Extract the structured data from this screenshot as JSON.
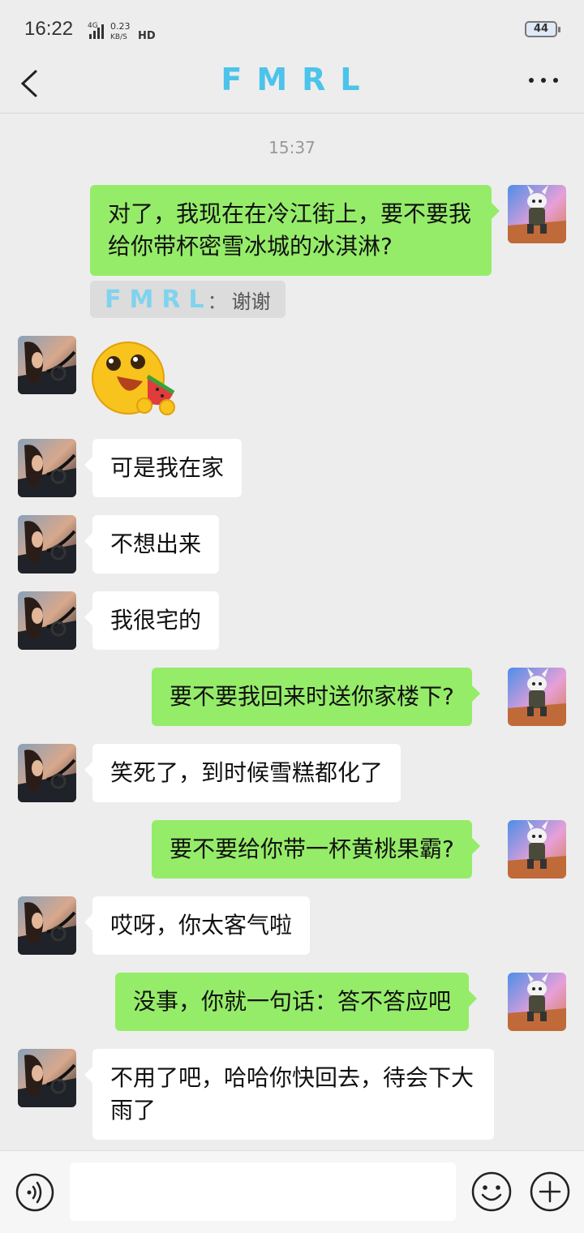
{
  "status": {
    "time": "16:22",
    "network": "4G",
    "speed": "0.23",
    "speed_unit": "KB/S",
    "hd": "HD",
    "battery": "44"
  },
  "header": {
    "title": "FMRL",
    "back_icon": "chevron-left-icon",
    "more_icon": "more-dots-icon"
  },
  "chat": {
    "timestamp": "15:37",
    "messages": [
      {
        "side": "right",
        "type": "text",
        "text": "对了，我现在在冷江街上，要不要我给你带杯密雪冰城的冰淇淋?"
      },
      {
        "side": "right",
        "type": "quote",
        "name": "FMRL",
        "sep": "：",
        "text": "谢谢"
      },
      {
        "side": "left",
        "type": "sticker",
        "icon": "watermelon-face-sticker"
      },
      {
        "side": "left",
        "type": "text",
        "text": "可是我在家"
      },
      {
        "side": "left",
        "type": "text",
        "text": "不想出来"
      },
      {
        "side": "left",
        "type": "text",
        "text": "我很宅的"
      },
      {
        "side": "right",
        "type": "text",
        "text": "要不要我回来时送你家楼下?"
      },
      {
        "side": "left",
        "type": "text",
        "text": "笑死了，到时候雪糕都化了"
      },
      {
        "side": "right",
        "type": "text",
        "text": "要不要给你带一杯黄桃果霸?"
      },
      {
        "side": "left",
        "type": "text",
        "text": "哎呀，你太客气啦"
      },
      {
        "side": "right",
        "type": "text",
        "text": "没事，你就一句话：答不答应吧"
      },
      {
        "side": "left",
        "type": "text",
        "text": "不用了吧，哈哈你快回去，待会下大雨了"
      }
    ]
  },
  "input_bar": {
    "voice_icon": "voice-icon",
    "input_value": "",
    "emoji_icon": "emoji-icon",
    "plus_icon": "plus-icon"
  },
  "colors": {
    "title": "#4cc3ea",
    "sent_bubble": "#95ec69",
    "received_bubble": "#ffffff",
    "background": "#ededed"
  }
}
